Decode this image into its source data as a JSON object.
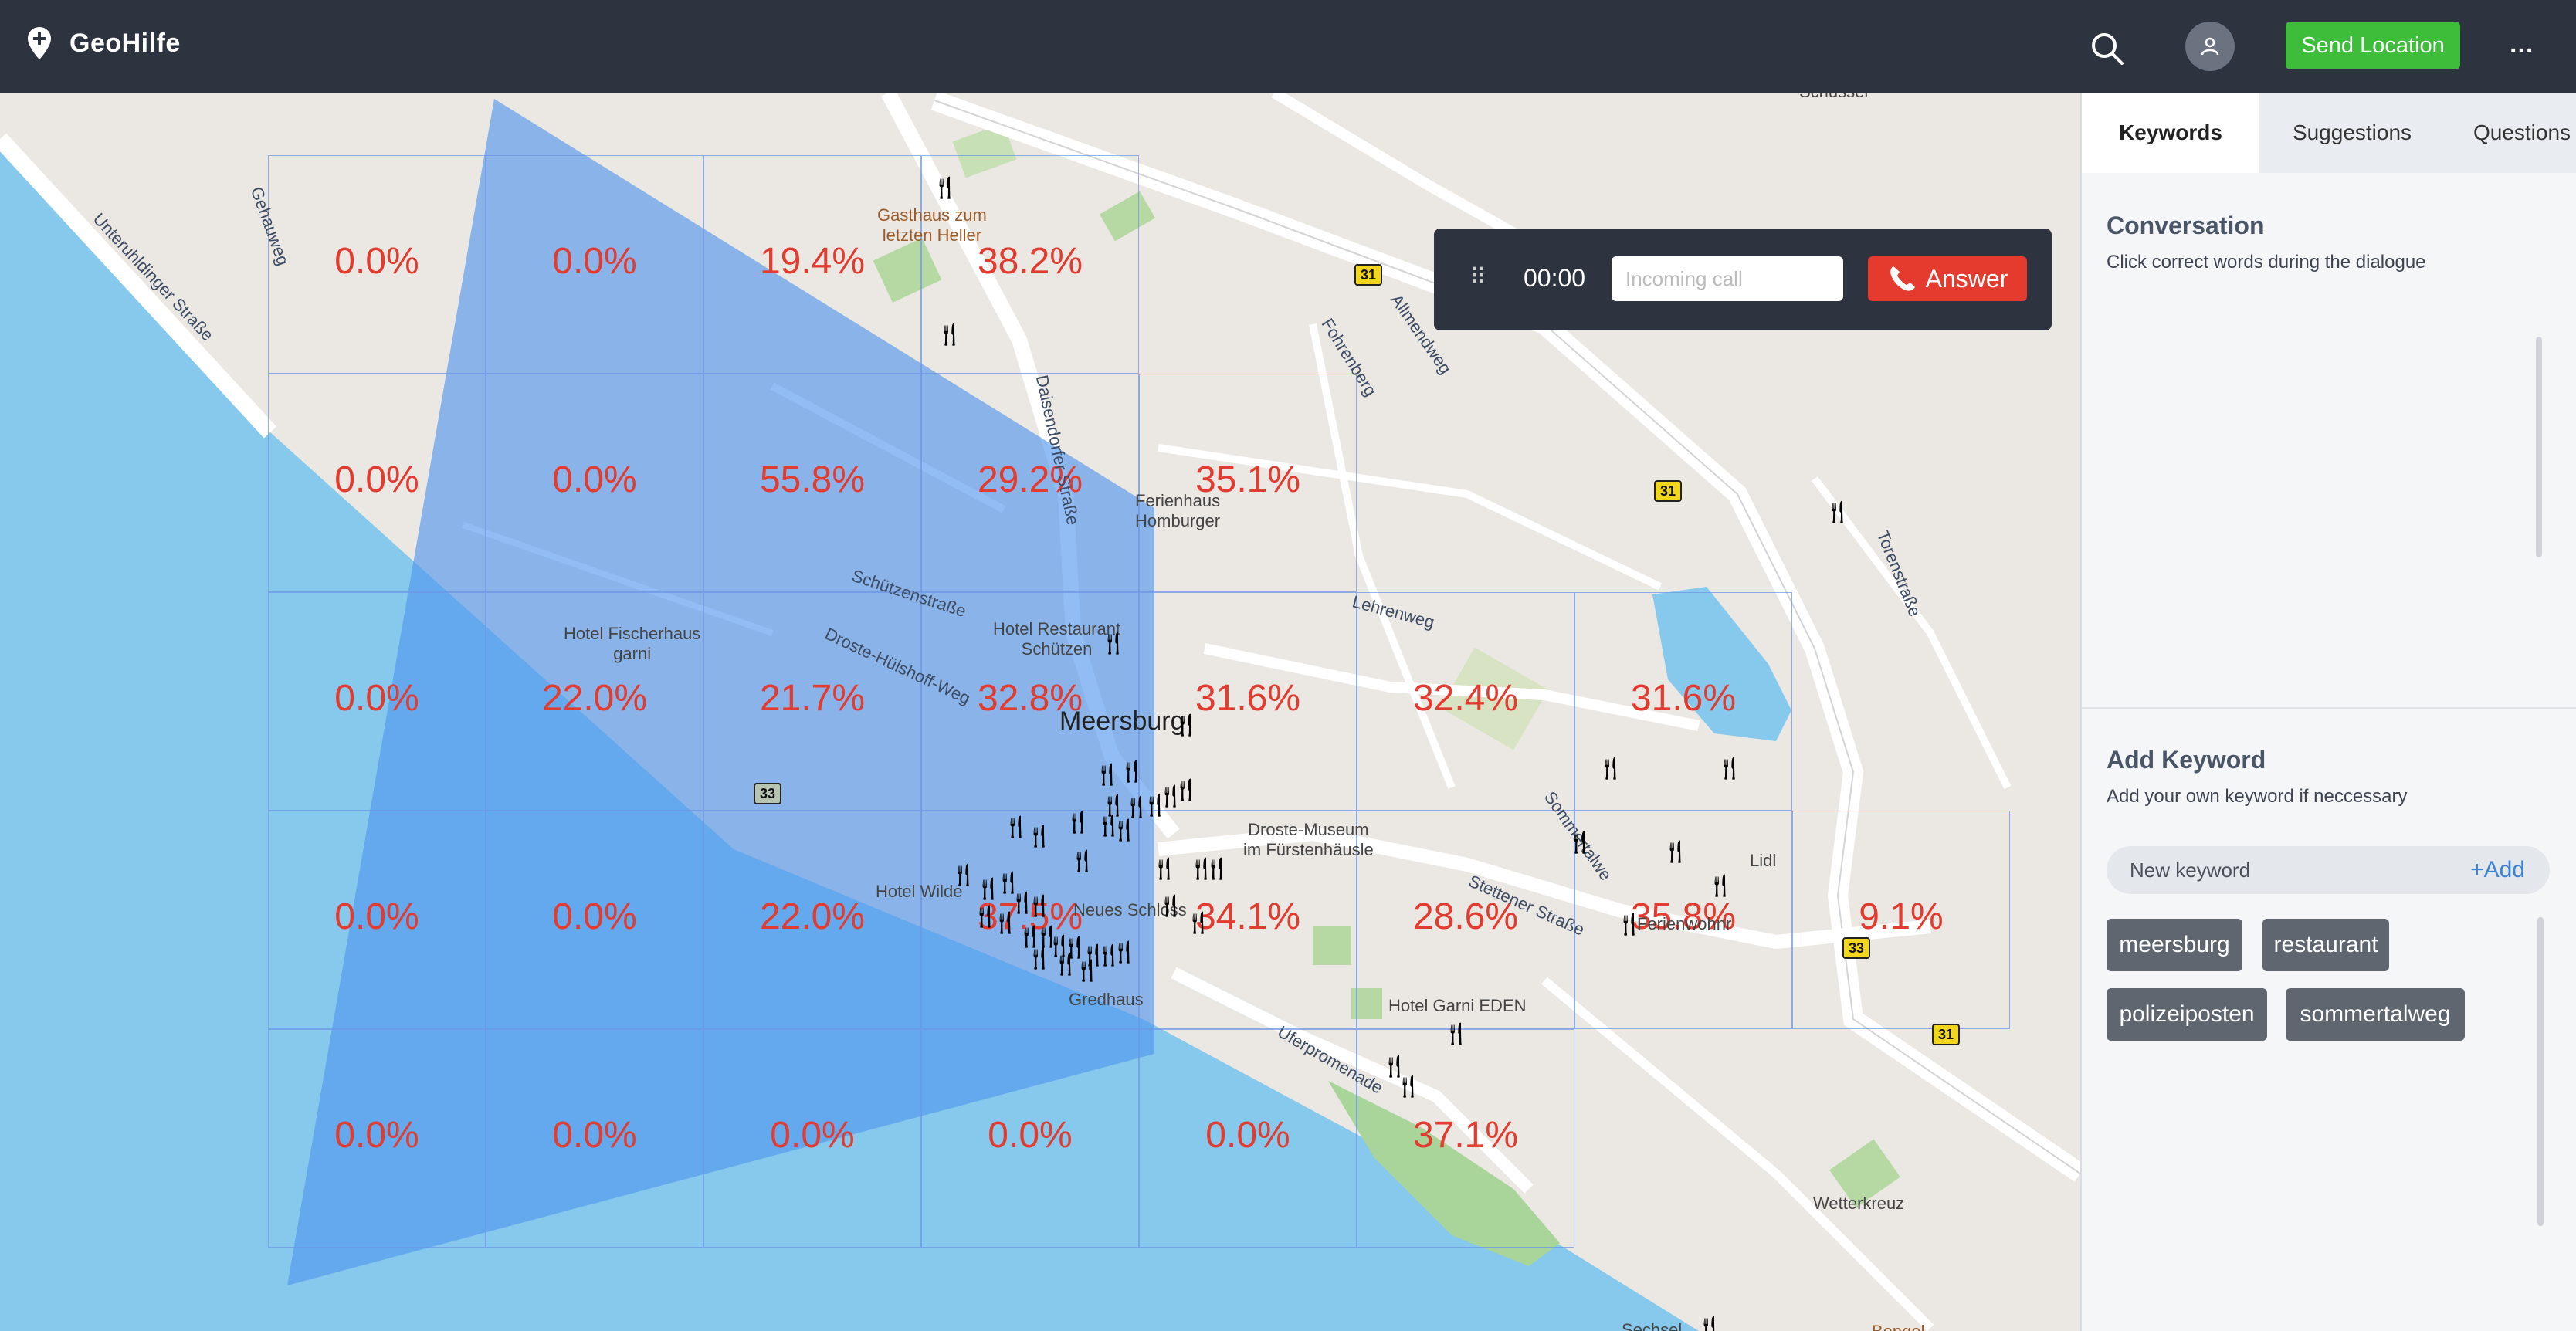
{
  "app": {
    "name": "GeoHilfe",
    "send_location": "Send Location",
    "more": "..."
  },
  "call": {
    "drag": "⠿",
    "timer": "00:00",
    "input_placeholder": "Incoming call",
    "answer": "Answer"
  },
  "map": {
    "grid_percentages": [
      [
        "0.0%",
        "0.0%",
        "19.4%",
        "38.2%",
        "",
        "",
        "",
        ""
      ],
      [
        "0.0%",
        "0.0%",
        "55.8%",
        "29.2%",
        "35.1%",
        "",
        "",
        ""
      ],
      [
        "0.0%",
        "22.0%",
        "21.7%",
        "32.8%",
        "31.6%",
        "32.4%",
        "31.6%",
        ""
      ],
      [
        "0.0%",
        "0.0%",
        "22.0%",
        "37.5%",
        "34.1%",
        "28.6%",
        "35.8%",
        "9.1%"
      ],
      [
        "0.0%",
        "0.0%",
        "0.0%",
        "0.0%",
        "0.0%",
        "37.1%",
        "",
        ""
      ]
    ],
    "labels": {
      "city": "Meersburg",
      "gasthaus": "Gasthaus zum\nletzten Heller",
      "ferienhaus": "Ferienhaus\nHomburger",
      "hotel_fischerhaus": "Hotel Fischerhaus\ngarni",
      "hotel_restaurant": "Hotel Restaurant\nSchützen",
      "droste_museum": "Droste-Museum\nim Fürstenhäusle",
      "hotel_wilde": "Hotel Wilde",
      "neues_schloss": "Neues Schloss",
      "gredhaus": "Gredhaus",
      "hotel_garni": "Hotel Garni EDEN",
      "lidl": "Lidl",
      "wetterkreuz": "Wetterkreuz",
      "ferienwohnung": "Ferienwohnr",
      "schussel": "Schussel",
      "sechsel": "Sechsel",
      "bengel": "Bengel"
    },
    "streets": {
      "unteruhldinger": "Unteruhldinger Straße",
      "gehauweg": "Gehauweg",
      "daisendorfer": "Daisendorfer Straße",
      "fohrenberg": "Fohrenberg",
      "allmendweg": "Allmendweg",
      "lehrenweg": "Lehrenweg",
      "torenstrasse": "Torenstraße",
      "schuetzenstrasse": "Schützenstraße",
      "droste_huelshoff": "Droste-Hülshoff-Weg",
      "sommertal": "Sommertalwe",
      "stettener": "Stettener Straße",
      "uferpromenade": "Uferpromenade"
    },
    "shields": [
      "31",
      "31",
      "33",
      "33",
      "31"
    ]
  },
  "panel": {
    "tabs": [
      "Keywords",
      "Suggestions",
      "Questions"
    ],
    "conversation_title": "Conversation",
    "conversation_sub": "Click correct words during the dialogue",
    "add_keyword_title": "Add Keyword",
    "add_keyword_sub": "Add your own keyword if neccessary",
    "keyword_placeholder": "New keyword",
    "add_label": "+Add",
    "keywords": [
      "meersburg",
      "restaurant",
      "polizeiposten",
      "sommertalweg"
    ]
  },
  "colors": {
    "header": "#2e3340",
    "accent_green": "#3dbd3a",
    "answer_red": "#e53a2e",
    "percent_red": "#e23b2f",
    "water": "#86c9ec",
    "overlay_blue": "#5aa0ee"
  },
  "icons": {
    "logo": "map-pin-plus-icon",
    "search": "search-icon",
    "user": "user-icon",
    "drag": "drag-handle-icon",
    "phone": "phone-icon",
    "restaurant": "fork-knife-icon"
  }
}
